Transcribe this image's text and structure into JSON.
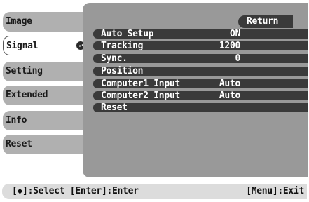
{
  "sidebar": {
    "items": [
      {
        "label": "Image"
      },
      {
        "label": "Signal",
        "active": true,
        "icon": "enter-icon"
      },
      {
        "label": "Setting"
      },
      {
        "label": "Extended"
      },
      {
        "label": "Info"
      },
      {
        "label": "Reset"
      }
    ]
  },
  "panel": {
    "return_label": "Return",
    "rows": [
      {
        "label": "Auto Setup",
        "value": "ON"
      },
      {
        "label": "Tracking",
        "value": "1200"
      },
      {
        "label": "Sync.",
        "value": "0"
      },
      {
        "label": "Position",
        "value": ""
      },
      {
        "label": "Computer1 Input",
        "value": "Auto"
      },
      {
        "label": "Computer2 Input",
        "value": "Auto"
      },
      {
        "label": "Reset",
        "value": ""
      }
    ]
  },
  "footer": {
    "left_hint": "[◆]:Select [Enter]:Enter",
    "right_hint": "[Menu]:Exit"
  }
}
